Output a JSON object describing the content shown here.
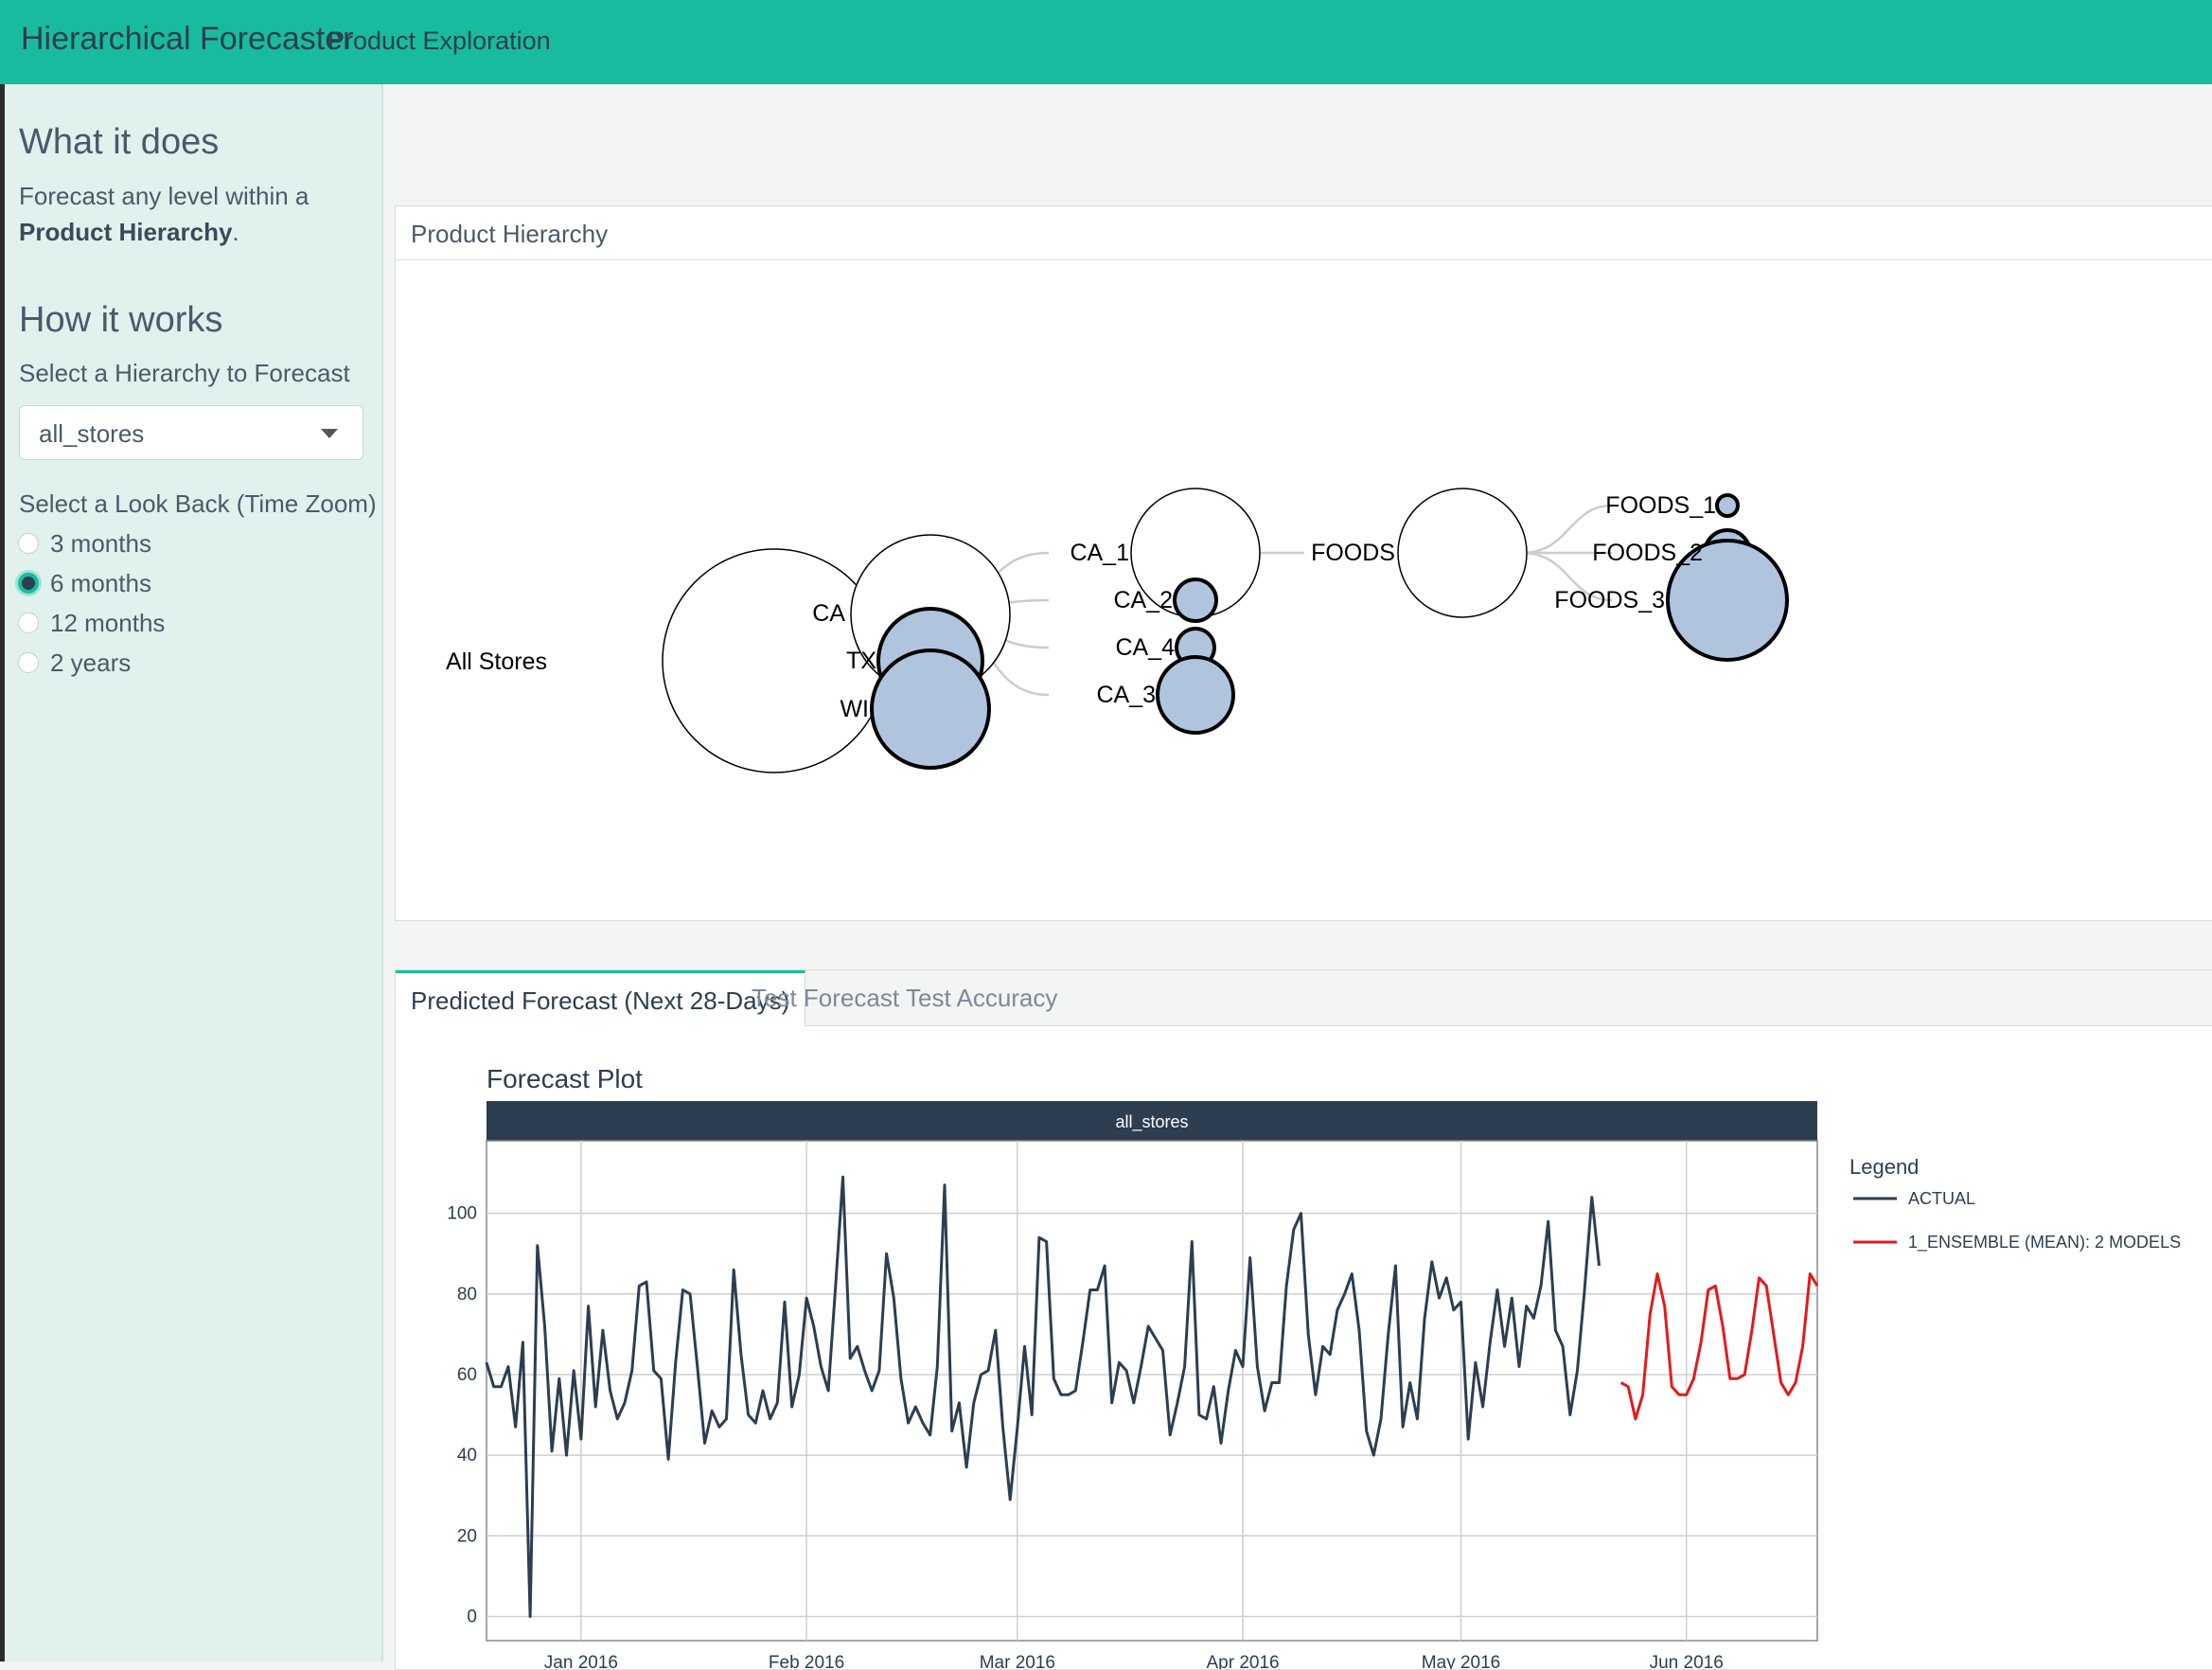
{
  "navbar": {
    "brand": "Hierarchical Forecaster",
    "link": "Product Exploration",
    "color": "#18bc9c"
  },
  "sidebar": {
    "what_heading": "What it does",
    "what_text_prefix": "Forecast any level within a ",
    "what_text_bold": "Product Hierarchy",
    "what_text_suffix": ".",
    "how_heading": "How it works",
    "hierarchy_label": "Select a Hierarchy to Forecast",
    "hierarchy_value": "all_stores",
    "lookback_label": "Select a Look Back (Time Zoom)",
    "lookback_options": [
      "3 months",
      "6 months",
      "12 months",
      "2 years"
    ],
    "lookback_selected": "6 months"
  },
  "hierarchy_card": {
    "title": "Product Hierarchy",
    "nodes": {
      "all_stores": "All Stores",
      "ca": "CA",
      "tx": "TX",
      "wi": "WI",
      "ca_1": "CA_1",
      "ca_2": "CA_2",
      "ca_3": "CA_3",
      "ca_4": "CA_4",
      "foods": "FOODS",
      "foods_1": "FOODS_1",
      "foods_2": "FOODS_2",
      "foods_3": "FOODS_3"
    },
    "leaf_color": "#b0c4de"
  },
  "tabs": {
    "items": [
      "Predicted Forecast (Next 28-Days)",
      "Test Forecast",
      "Test Accuracy"
    ],
    "active": "Predicted Forecast (Next 28-Days)"
  },
  "chart_data": {
    "type": "line",
    "title": "Forecast Plot",
    "facet_label": "all_stores",
    "xlabel": "",
    "ylabel": "",
    "x_ticks": [
      "Jan 2016",
      "Feb 2016",
      "Mar 2016",
      "Apr 2016",
      "May 2016",
      "Jun 2016"
    ],
    "y_ticks": [
      0,
      20,
      40,
      60,
      80,
      100
    ],
    "ylim": [
      -6,
      118
    ],
    "x_range": [
      "2015-12-19",
      "2016-06-19"
    ],
    "grid": true,
    "legend_title": "Legend",
    "legend_position": "right",
    "series": [
      {
        "name": "ACTUAL",
        "color": "#2c3e50",
        "start": "2015-12-19",
        "values": [
          63,
          57,
          57,
          62,
          47,
          68,
          0,
          92,
          72,
          41,
          59,
          40,
          61,
          44,
          77,
          52,
          71,
          56,
          49,
          53,
          61,
          82,
          83,
          61,
          59,
          39,
          63,
          81,
          80,
          62,
          43,
          51,
          47,
          49,
          86,
          65,
          50,
          48,
          56,
          49,
          53,
          78,
          52,
          60,
          79,
          72,
          62,
          56,
          82,
          109,
          64,
          67,
          61,
          56,
          61,
          90,
          79,
          59,
          48,
          52,
          48,
          45,
          62,
          107,
          46,
          53,
          37,
          53,
          60,
          61,
          71,
          47,
          29,
          47,
          67,
          50,
          94,
          93,
          59,
          55,
          55,
          56,
          68,
          81,
          81,
          87,
          53,
          63,
          61,
          53,
          62,
          72,
          69,
          66,
          45,
          53,
          62,
          93,
          50,
          49,
          57,
          43,
          56,
          66,
          62,
          89,
          62,
          51,
          58,
          58,
          82,
          96,
          100,
          70,
          55,
          67,
          65,
          76,
          80,
          85,
          71,
          46,
          40,
          49,
          70,
          87,
          47,
          58,
          49,
          74,
          88,
          79,
          84,
          76,
          78,
          44,
          63,
          52,
          68,
          81,
          67,
          79,
          62,
          77,
          74,
          82,
          98,
          71,
          67,
          50,
          61,
          81,
          104,
          87
        ],
        "end_label": "2016-05-22"
      },
      {
        "name": "1_ENSEMBLE (MEAN): 2 MODELS",
        "color": "#e31a1c",
        "start": "2016-05-23",
        "values": [
          58,
          57,
          49,
          55,
          75,
          85,
          77,
          57,
          55,
          55,
          59,
          68,
          81,
          82,
          72,
          59,
          59,
          60,
          71,
          84,
          82,
          70,
          58,
          55,
          58,
          67,
          85,
          82
        ]
      }
    ]
  }
}
